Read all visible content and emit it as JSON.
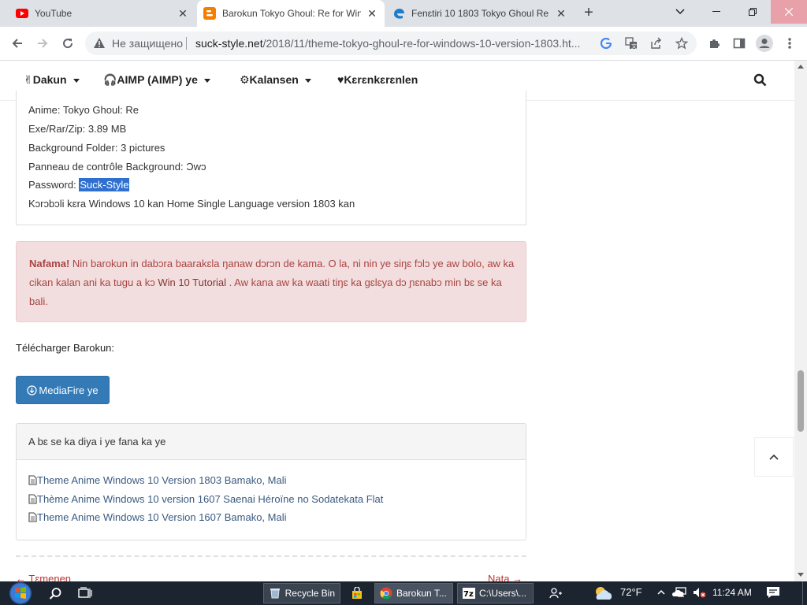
{
  "browser": {
    "tabs": [
      {
        "title": "YouTube",
        "icon": "youtube-icon",
        "active": false
      },
      {
        "title": "Barokun Tokyo Ghoul: Re for Win",
        "icon": "blogger-icon",
        "active": true
      },
      {
        "title": "Fenɛtiri 10 1803 Tokyo Ghoul Re",
        "icon": "edge-icon",
        "active": false
      }
    ],
    "security_label": "Не защищено",
    "url_host": "suck-style.net",
    "url_path": "/2018/11/theme-tokyo-ghoul-re-for-windows-10-version-1803.ht..."
  },
  "site_nav": {
    "items": [
      {
        "label": "✌Dakun",
        "has_caret": true
      },
      {
        "label": "🎧AIMP (AIMP) ye",
        "has_caret": true
      },
      {
        "label": "⚙Kalansen",
        "has_caret": true
      },
      {
        "label": "♥Kɛrɛnkɛrɛnlen",
        "has_caret": false
      }
    ]
  },
  "info": {
    "anime": "Anime: Tokyo Ghoul: Re",
    "size": "Exe/Rar/Zip: 3.89 MB",
    "background_folder": "Background Folder: 3 pictures",
    "panel_bg": "Panneau de contrôle Background: Ɔwɔ",
    "password_label": "Password: ",
    "password_value": "Suck-Style",
    "compat": "Kɔrɔbɔli kɛra Windows 10 kan Home Single Language version 1803 kan"
  },
  "alert": {
    "strong": "Nafama!",
    "text1": " Nin barokun in dabɔra baarakɛla ŋanaw dɔrɔn de kama. O la, ni nin ye siŋɛ fɔlɔ ye aw bolo, aw ka cikan kalan ani ka tugu a kɔ ",
    "link": "Win 10 Tutorial",
    "text2": " . Aw kana aw ka waati tiŋɛ ka gɛlɛya dɔ ɲɛnabɔ min bɛ se ka bali."
  },
  "download": {
    "label": "Télécharger Barokun:",
    "button": "MediaFire ye"
  },
  "related": {
    "title": "A bɛ se ka diya i ye fana ka ye",
    "items": [
      "Theme Anime Windows 10 Version 1803 Bamako, Mali",
      "Thème Anime Windows 10 version 1607 Saenai Héroïne no Sodatekata Flat",
      "Theme Anime Windows 10 Version 1607 Bamako, Mali"
    ]
  },
  "post_nav": {
    "prev": "← Tɛmenen",
    "next": "Nata →"
  },
  "taskbar": {
    "recycle_bin": "Recycle Bin",
    "chrome": "Barokun T...",
    "cmd": "C:\\Users\\...",
    "weather": "72°F",
    "time": "11:24 AM"
  }
}
